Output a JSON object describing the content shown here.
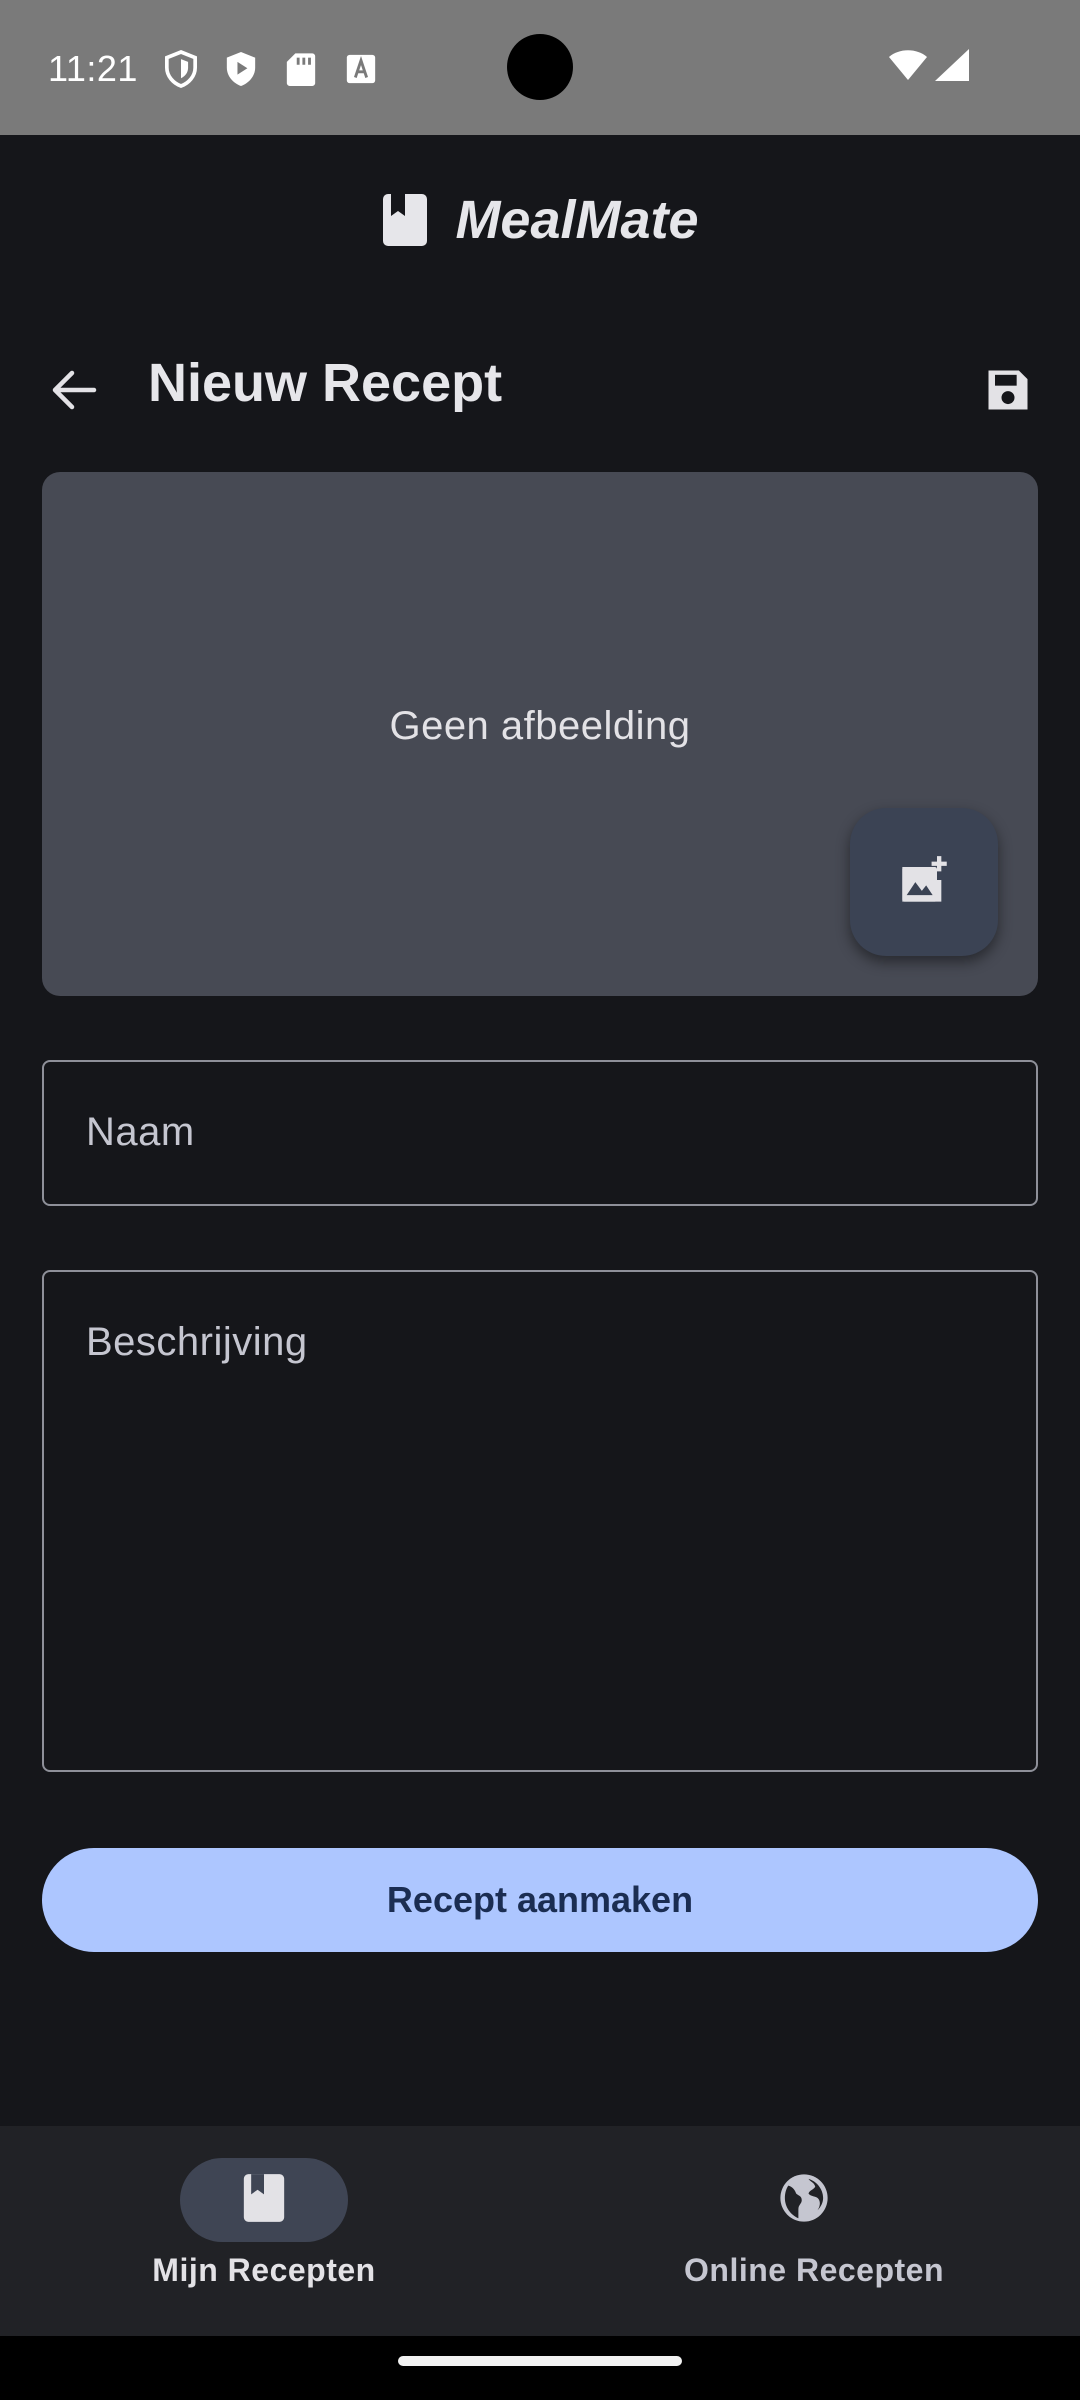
{
  "status_bar": {
    "time": "11:21",
    "left_icons": [
      "shield-outline-icon",
      "shield-play-icon",
      "sd-card-icon",
      "text-a-icon"
    ],
    "right_icons": [
      "wifi-icon",
      "signal-icon"
    ]
  },
  "app": {
    "title": "MealMate",
    "logo_icon": "bookmark-book-icon"
  },
  "toolbar": {
    "title": "Nieuw Recept",
    "back_icon": "arrow-back-icon",
    "save_icon": "save-disk-icon"
  },
  "image_area": {
    "placeholder": "Geen afbeelding",
    "add_icon": "add-photo-icon"
  },
  "form": {
    "name_placeholder": "Naam",
    "name_value": "",
    "description_placeholder": "Beschrijving",
    "description_value": "",
    "submit_label": "Recept aanmaken"
  },
  "bottom_nav": {
    "items": [
      {
        "label": "Mijn Recepten",
        "icon": "bookmark-book-icon",
        "selected": true
      },
      {
        "label": "Online Recepten",
        "icon": "globe-icon",
        "selected": false
      }
    ]
  },
  "colors": {
    "background": "#15161a",
    "status_bar": "#7a7a7a",
    "surface": "#474a54",
    "primary_button": "#adc6ff",
    "primary_button_text": "#1b2d52",
    "nav_background": "#212226",
    "nav_indicator": "#3f4554"
  }
}
